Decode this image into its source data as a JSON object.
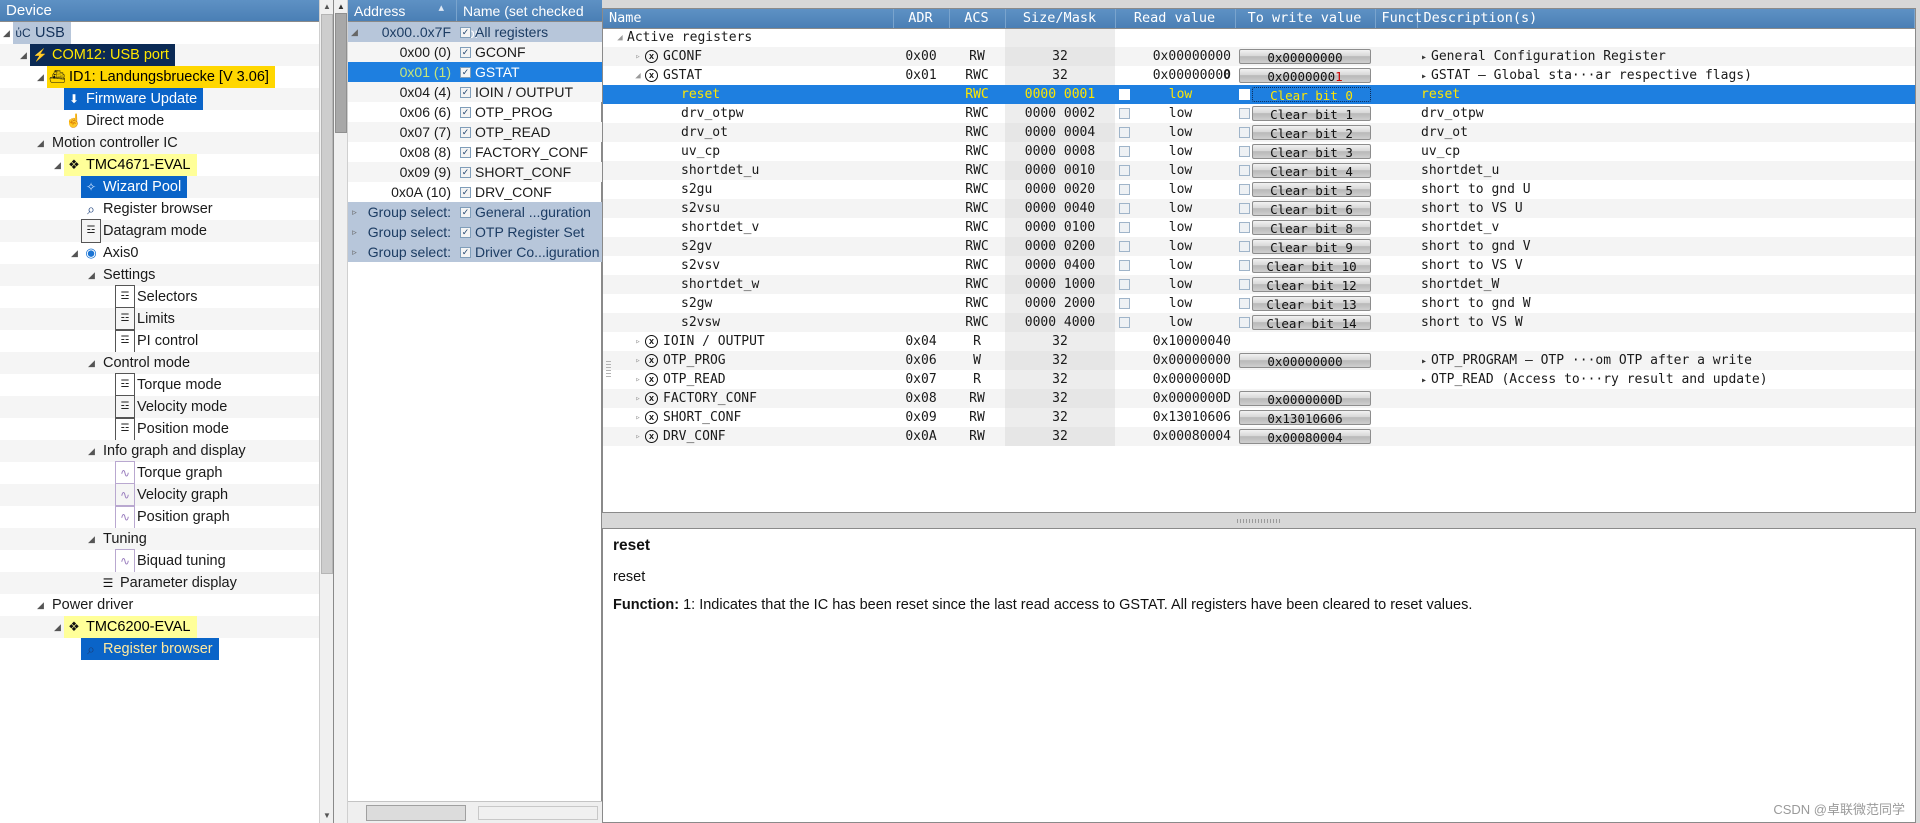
{
  "device_panel": {
    "header": "Device",
    "tree": [
      {
        "indent": 0,
        "expander": "◢",
        "icon": "usb-icon",
        "label": "USB",
        "style": "sel-steel"
      },
      {
        "indent": 1,
        "expander": "◢",
        "icon": "plug-icon",
        "label": "COM12: USB port",
        "style": "sel-navy"
      },
      {
        "indent": 2,
        "expander": "◢",
        "icon": "board-icon",
        "label": "ID1: Landungsbruecke [V 3.06]",
        "style": "sel-gold"
      },
      {
        "indent": 3,
        "expander": "",
        "icon": "download-icon",
        "label": "Firmware Update",
        "style": "sel-blue"
      },
      {
        "indent": 3,
        "expander": "",
        "icon": "hand-icon",
        "label": "Direct mode",
        "style": "none"
      },
      {
        "indent": 2,
        "expander": "◢",
        "icon": "",
        "label": "Motion controller IC",
        "style": "none"
      },
      {
        "indent": 3,
        "expander": "◢",
        "icon": "chip-icon",
        "label": "TMC4671-EVAL",
        "style": "sel-yellow"
      },
      {
        "indent": 4,
        "expander": "",
        "icon": "wizard-icon",
        "label": "Wizard Pool",
        "style": "sel-blue"
      },
      {
        "indent": 4,
        "expander": "",
        "icon": "magnifier-icon",
        "label": "Register browser",
        "style": "none"
      },
      {
        "indent": 4,
        "expander": "",
        "icon": "sliders-icon",
        "label": "Datagram mode",
        "style": "none"
      },
      {
        "indent": 4,
        "expander": "◢",
        "icon": "axis-icon",
        "label": "Axis0",
        "style": "none"
      },
      {
        "indent": 5,
        "expander": "◢",
        "icon": "",
        "label": "Settings",
        "style": "none"
      },
      {
        "indent": 6,
        "expander": "",
        "icon": "sliders-icon",
        "label": "Selectors",
        "style": "none"
      },
      {
        "indent": 6,
        "expander": "",
        "icon": "sliders-icon",
        "label": "Limits",
        "style": "none"
      },
      {
        "indent": 6,
        "expander": "",
        "icon": "sliders-icon",
        "label": "PI control",
        "style": "none"
      },
      {
        "indent": 5,
        "expander": "◢",
        "icon": "",
        "label": "Control mode",
        "style": "none"
      },
      {
        "indent": 6,
        "expander": "",
        "icon": "sliders-icon",
        "label": "Torque mode",
        "style": "none"
      },
      {
        "indent": 6,
        "expander": "",
        "icon": "sliders-icon",
        "label": "Velocity mode",
        "style": "none"
      },
      {
        "indent": 6,
        "expander": "",
        "icon": "sliders-icon",
        "label": "Position mode",
        "style": "none"
      },
      {
        "indent": 5,
        "expander": "◢",
        "icon": "",
        "label": "Info graph and display",
        "style": "none"
      },
      {
        "indent": 6,
        "expander": "",
        "icon": "graph-icon",
        "label": "Torque graph",
        "style": "none"
      },
      {
        "indent": 6,
        "expander": "",
        "icon": "graph-icon",
        "label": "Velocity graph",
        "style": "none"
      },
      {
        "indent": 6,
        "expander": "",
        "icon": "graph-icon",
        "label": "Position graph",
        "style": "none"
      },
      {
        "indent": 5,
        "expander": "◢",
        "icon": "",
        "label": "Tuning",
        "style": "none"
      },
      {
        "indent": 6,
        "expander": "",
        "icon": "graph-icon",
        "label": "Biquad tuning",
        "style": "none"
      },
      {
        "indent": 5,
        "expander": "",
        "icon": "list-icon",
        "label": "Parameter display",
        "style": "none"
      },
      {
        "indent": 2,
        "expander": "◢",
        "icon": "",
        "label": "Power driver",
        "style": "none"
      },
      {
        "indent": 3,
        "expander": "◢",
        "icon": "chip-icon",
        "label": "TMC6200-EVAL",
        "style": "sel-yellow"
      },
      {
        "indent": 4,
        "expander": "",
        "icon": "magnifier-icon",
        "label": "Register browser",
        "style": "sel-blue2"
      }
    ]
  },
  "address_panel": {
    "header": {
      "address": "Address",
      "name": "Name (set checked for"
    },
    "rows": [
      {
        "expander": "◢",
        "address": "0x00..0x7F",
        "checked": true,
        "name": "All registers",
        "state": "allreg"
      },
      {
        "expander": "",
        "address": "0x00 (0)",
        "checked": true,
        "name": "GCONF",
        "state": "normal"
      },
      {
        "expander": "",
        "address": "0x01 (1)",
        "checked": true,
        "name": "GSTAT",
        "state": "selected"
      },
      {
        "expander": "",
        "address": "0x04 (4)",
        "checked": true,
        "name": "IOIN / OUTPUT",
        "state": "normal"
      },
      {
        "expander": "",
        "address": "0x06 (6)",
        "checked": true,
        "name": "OTP_PROG",
        "state": "normal"
      },
      {
        "expander": "",
        "address": "0x07 (7)",
        "checked": true,
        "name": "OTP_READ",
        "state": "normal"
      },
      {
        "expander": "",
        "address": "0x08 (8)",
        "checked": true,
        "name": "FACTORY_CONF",
        "state": "normal"
      },
      {
        "expander": "",
        "address": "0x09 (9)",
        "checked": true,
        "name": "SHORT_CONF",
        "state": "normal"
      },
      {
        "expander": "",
        "address": "0x0A (10)",
        "checked": true,
        "name": "DRV_CONF",
        "state": "normal"
      },
      {
        "expander": "▹",
        "address": "Group select:",
        "checked": true,
        "name": "General ...guration",
        "state": "group"
      },
      {
        "expander": "▹",
        "address": "Group select:",
        "checked": true,
        "name": "OTP Register Set",
        "state": "group"
      },
      {
        "expander": "▹",
        "address": "Group select:",
        "checked": true,
        "name": "Driver Co...iguration",
        "state": "group"
      }
    ]
  },
  "register_table": {
    "columns": [
      "Name",
      "ADR",
      "ACS",
      "Size/Mask",
      "Read value",
      "To write value",
      "Funct",
      "Description(s)"
    ],
    "rows": [
      {
        "level": 0,
        "expander": "◢",
        "xicon": false,
        "name": "Active registers",
        "adr": "",
        "acs": "",
        "size": "",
        "read": "",
        "write": "",
        "write_is_button": false,
        "check": false,
        "desc": "",
        "desc_arrow": false,
        "selected": false
      },
      {
        "level": 1,
        "expander": "▹",
        "xicon": true,
        "name": "GCONF",
        "adr": "0x00",
        "acs": "RW",
        "size": "32",
        "read": "0x00000000",
        "write": "0x00000000",
        "write_is_button": true,
        "check": false,
        "desc": "General Configuration Register",
        "desc_arrow": true,
        "selected": false
      },
      {
        "level": 1,
        "expander": "◢",
        "xicon": true,
        "name": "GSTAT",
        "adr": "0x01",
        "acs": "RWC",
        "size": "32",
        "read": "0x00000000",
        "write": "0x00000001",
        "write_is_button": true,
        "check": false,
        "desc": "GSTAT – Global sta···ar respective flags)",
        "desc_arrow": true,
        "selected": false
      },
      {
        "level": 2,
        "expander": "",
        "xicon": false,
        "name": "reset",
        "adr": "",
        "acs": "RWC",
        "size": "0000 0001",
        "read": "low",
        "write": "Clear bit 0",
        "write_is_button": true,
        "check": true,
        "desc": "reset",
        "desc_arrow": false,
        "selected": true
      },
      {
        "level": 2,
        "expander": "",
        "xicon": false,
        "name": "drv_otpw",
        "adr": "",
        "acs": "RWC",
        "size": "0000 0002",
        "read": "low",
        "write": "Clear bit 1",
        "write_is_button": true,
        "check": true,
        "desc": "drv_otpw",
        "desc_arrow": false,
        "selected": false
      },
      {
        "level": 2,
        "expander": "",
        "xicon": false,
        "name": "drv_ot",
        "adr": "",
        "acs": "RWC",
        "size": "0000 0004",
        "read": "low",
        "write": "Clear bit 2",
        "write_is_button": true,
        "check": true,
        "desc": "drv_ot",
        "desc_arrow": false,
        "selected": false
      },
      {
        "level": 2,
        "expander": "",
        "xicon": false,
        "name": "uv_cp",
        "adr": "",
        "acs": "RWC",
        "size": "0000 0008",
        "read": "low",
        "write": "Clear bit 3",
        "write_is_button": true,
        "check": true,
        "desc": "uv_cp",
        "desc_arrow": false,
        "selected": false
      },
      {
        "level": 2,
        "expander": "",
        "xicon": false,
        "name": "shortdet_u",
        "adr": "",
        "acs": "RWC",
        "size": "0000 0010",
        "read": "low",
        "write": "Clear bit 4",
        "write_is_button": true,
        "check": true,
        "desc": "shortdet_u",
        "desc_arrow": false,
        "selected": false
      },
      {
        "level": 2,
        "expander": "",
        "xicon": false,
        "name": "s2gu",
        "adr": "",
        "acs": "RWC",
        "size": "0000 0020",
        "read": "low",
        "write": "Clear bit 5",
        "write_is_button": true,
        "check": true,
        "desc": "short to gnd U",
        "desc_arrow": false,
        "selected": false
      },
      {
        "level": 2,
        "expander": "",
        "xicon": false,
        "name": "s2vsu",
        "adr": "",
        "acs": "RWC",
        "size": "0000 0040",
        "read": "low",
        "write": "Clear bit 6",
        "write_is_button": true,
        "check": true,
        "desc": "short to VS U",
        "desc_arrow": false,
        "selected": false
      },
      {
        "level": 2,
        "expander": "",
        "xicon": false,
        "name": "shortdet_v",
        "adr": "",
        "acs": "RWC",
        "size": "0000 0100",
        "read": "low",
        "write": "Clear bit 8",
        "write_is_button": true,
        "check": true,
        "desc": "shortdet_v",
        "desc_arrow": false,
        "selected": false
      },
      {
        "level": 2,
        "expander": "",
        "xicon": false,
        "name": "s2gv",
        "adr": "",
        "acs": "RWC",
        "size": "0000 0200",
        "read": "low",
        "write": "Clear bit 9",
        "write_is_button": true,
        "check": true,
        "desc": "short to gnd V",
        "desc_arrow": false,
        "selected": false
      },
      {
        "level": 2,
        "expander": "",
        "xicon": false,
        "name": "s2vsv",
        "adr": "",
        "acs": "RWC",
        "size": "0000 0400",
        "read": "low",
        "write": "Clear bit 10",
        "write_is_button": true,
        "check": true,
        "desc": "short to VS V",
        "desc_arrow": false,
        "selected": false
      },
      {
        "level": 2,
        "expander": "",
        "xicon": false,
        "name": "shortdet_w",
        "adr": "",
        "acs": "RWC",
        "size": "0000 1000",
        "read": "low",
        "write": "Clear bit 12",
        "write_is_button": true,
        "check": true,
        "desc": "shortdet_W",
        "desc_arrow": false,
        "selected": false
      },
      {
        "level": 2,
        "expander": "",
        "xicon": false,
        "name": "s2gw",
        "adr": "",
        "acs": "RWC",
        "size": "0000 2000",
        "read": "low",
        "write": "Clear bit 13",
        "write_is_button": true,
        "check": true,
        "desc": "short to gnd W",
        "desc_arrow": false,
        "selected": false
      },
      {
        "level": 2,
        "expander": "",
        "xicon": false,
        "name": "s2vsw",
        "adr": "",
        "acs": "RWC",
        "size": "0000 4000",
        "read": "low",
        "write": "Clear bit 14",
        "write_is_button": true,
        "check": true,
        "desc": "short to VS W",
        "desc_arrow": false,
        "selected": false
      },
      {
        "level": 1,
        "expander": "▹",
        "xicon": true,
        "name": "IOIN / OUTPUT",
        "adr": "0x04",
        "acs": "R",
        "size": "32",
        "read": "0x10000040",
        "write": "",
        "write_is_button": false,
        "check": false,
        "desc": "",
        "desc_arrow": false,
        "selected": false
      },
      {
        "level": 1,
        "expander": "▹",
        "xicon": true,
        "name": "OTP_PROG",
        "adr": "0x06",
        "acs": "W",
        "size": "32",
        "read": "0x00000000",
        "write": "0x00000000",
        "write_is_button": true,
        "check": false,
        "desc": "OTP_PROGRAM – OTP ···om OTP after a write",
        "desc_arrow": true,
        "selected": false
      },
      {
        "level": 1,
        "expander": "▹",
        "xicon": true,
        "name": "OTP_READ",
        "adr": "0x07",
        "acs": "R",
        "size": "32",
        "read": "0x0000000D",
        "write": "",
        "write_is_button": false,
        "check": false,
        "desc": "OTP_READ (Access to···ry result and update)",
        "desc_arrow": true,
        "selected": false
      },
      {
        "level": 1,
        "expander": "▹",
        "xicon": true,
        "name": "FACTORY_CONF",
        "adr": "0x08",
        "acs": "RW",
        "size": "32",
        "read": "0x0000000D",
        "write": "0x0000000D",
        "write_is_button": true,
        "check": false,
        "desc": "",
        "desc_arrow": false,
        "selected": false
      },
      {
        "level": 1,
        "expander": "▹",
        "xicon": true,
        "name": "SHORT_CONF",
        "adr": "0x09",
        "acs": "RW",
        "size": "32",
        "read": "0x13010606",
        "write": "0x13010606",
        "write_is_button": true,
        "check": false,
        "desc": "",
        "desc_arrow": false,
        "selected": false
      },
      {
        "level": 1,
        "expander": "▹",
        "xicon": true,
        "name": "DRV_CONF",
        "adr": "0x0A",
        "acs": "RW",
        "size": "32",
        "read": "0x00080004",
        "write": "0x00080004",
        "write_is_button": true,
        "check": false,
        "desc": "",
        "desc_arrow": false,
        "selected": false
      }
    ]
  },
  "description_pane": {
    "title": "reset",
    "subtitle": "reset",
    "function_label": "Function:",
    "function_text": " 1: Indicates that the IC has been reset since the last read access to GSTAT. All registers have been cleared to reset values."
  },
  "watermark": "CSDN @卓联微范同学",
  "colors": {
    "header_blue": "#4a7fb5",
    "selection_blue": "#1e7fe0",
    "gold": "#ffd700",
    "navy": "#0b2a55",
    "pale_yellow": "#ffff99",
    "selected_text_yellow": "#ffe600",
    "red_digit": "#cc0000"
  }
}
